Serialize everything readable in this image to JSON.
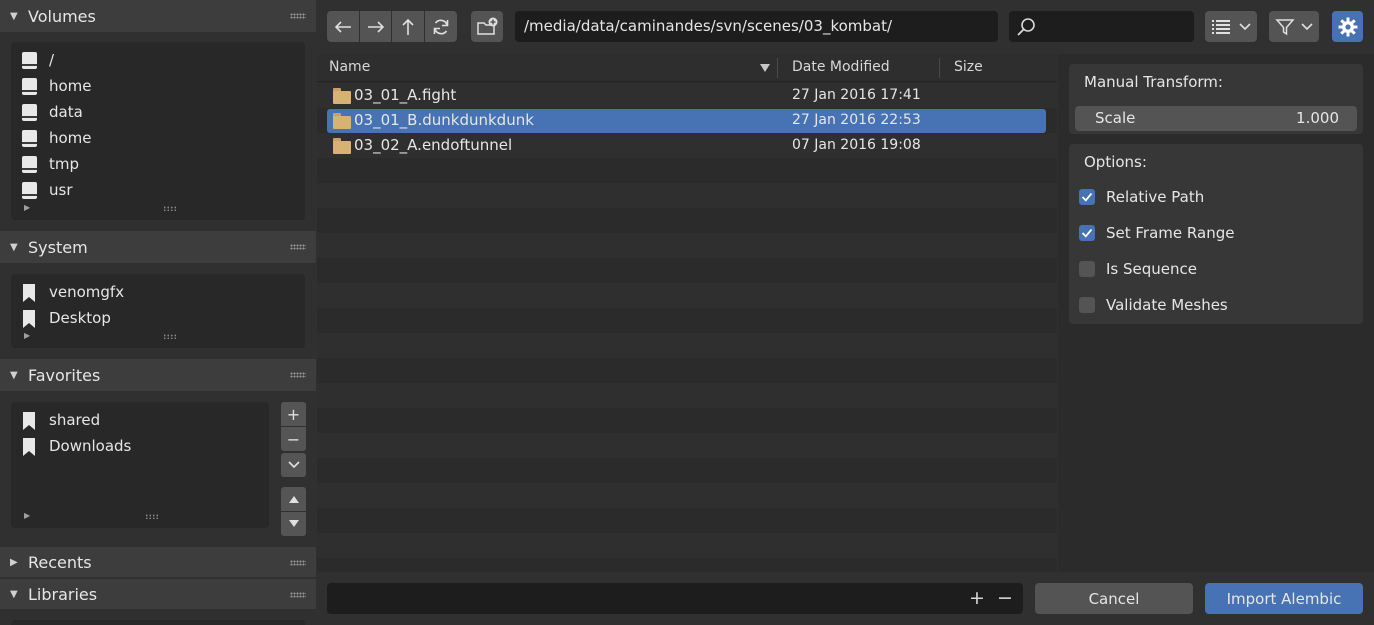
{
  "sidebar": {
    "volumes": {
      "title": "Volumes",
      "items": [
        {
          "label": "/"
        },
        {
          "label": "home"
        },
        {
          "label": "data"
        },
        {
          "label": "home"
        },
        {
          "label": "tmp"
        },
        {
          "label": "usr"
        }
      ]
    },
    "system": {
      "title": "System",
      "items": [
        {
          "label": "venomgfx"
        },
        {
          "label": "Desktop"
        }
      ]
    },
    "favorites": {
      "title": "Favorites",
      "items": [
        {
          "label": "shared"
        },
        {
          "label": "Downloads"
        }
      ]
    },
    "recents": {
      "title": "Recents"
    },
    "libraries": {
      "title": "Libraries"
    }
  },
  "toolbar": {
    "path": "/media/data/caminandes/svn/scenes/03_kombat/",
    "search_value": ""
  },
  "file_list": {
    "columns": {
      "name": "Name",
      "date": "Date Modified",
      "size": "Size"
    },
    "rows": [
      {
        "name": "03_01_A.fight",
        "date": "27 Jan 2016 17:41",
        "selected": false
      },
      {
        "name": "03_01_B.dunkdunkdunk",
        "date": "27 Jan 2016 22:53",
        "selected": true
      },
      {
        "name": "03_02_A.endoftunnel",
        "date": "07 Jan 2016 19:08",
        "selected": false
      }
    ]
  },
  "options": {
    "transform": {
      "title": "Manual Transform:",
      "scale_label": "Scale",
      "scale_value": "1.000"
    },
    "general": {
      "title": "Options:",
      "relative_path": "Relative Path",
      "set_frame_range": "Set Frame Range",
      "is_sequence": "Is Sequence",
      "validate_meshes": "Validate Meshes"
    }
  },
  "bottom": {
    "filename_value": "",
    "cancel_label": "Cancel",
    "import_label": "Import Alembic"
  },
  "colors": {
    "accent": "#4772b3",
    "background": "#303030",
    "field": "#1d1d1d",
    "button": "#545454"
  }
}
